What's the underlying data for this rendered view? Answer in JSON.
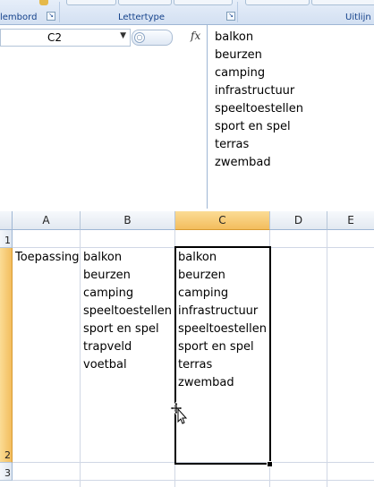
{
  "ribbon": {
    "groups": [
      {
        "label": "lembord"
      },
      {
        "label": "Lettertype"
      },
      {
        "label": "Uitlijn"
      }
    ]
  },
  "formula_bar": {
    "name_box": "C2",
    "fx_label": "fx",
    "lines": [
      "balkon",
      "beurzen",
      "camping",
      "infrastructuur",
      "speeltoestellen",
      "sport en spel",
      "terras",
      "zwembad"
    ]
  },
  "grid": {
    "columns": [
      "A",
      "B",
      "C",
      "D",
      "E"
    ],
    "selected_column": "C",
    "rows": [
      "1",
      "2",
      "3"
    ],
    "selected_row": "2",
    "cells": {
      "A2": "Toepassing",
      "B2": [
        "balkon",
        "beurzen",
        "camping",
        "speeltoestellen",
        "sport en spel",
        "trapveld",
        "voetbal"
      ],
      "C2": [
        "balkon",
        "beurzen",
        "camping",
        "infrastructuur",
        "speeltoestellen",
        "sport en spel",
        "terras",
        "zwembad"
      ]
    }
  },
  "colors": {
    "selection_header": "#f3bd5d",
    "ribbon_text": "#15428b",
    "gridline": "#d0d7e5"
  },
  "icons": {
    "cursor": "move-cursor-icon",
    "dialog_launcher": "dialog-launcher-icon",
    "format_painter": "format-painter-icon"
  }
}
